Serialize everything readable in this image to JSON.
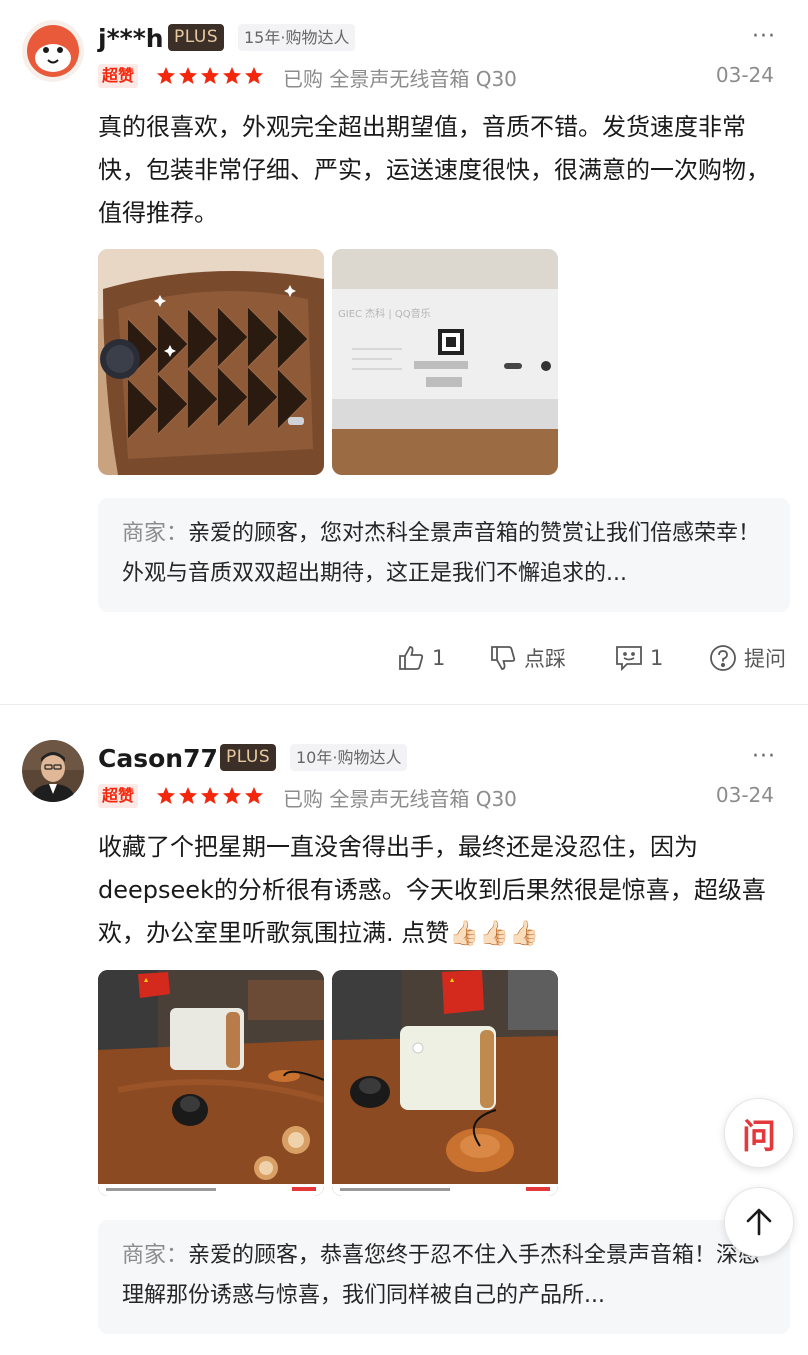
{
  "reviews": [
    {
      "username": "j***h",
      "plus": "PLUS",
      "years_tag": "15年·购物达人",
      "more": "···",
      "badge": "超赞",
      "rating": 5,
      "purchased": "已购 全景声无线音箱 Q30",
      "date": "03-24",
      "content": "真的很喜欢，外观完全超出期望值，音质不错。发货速度非常快，包装非常仔细、严实，运送速度很快，很满意的一次购物，值得推荐。",
      "photos": [
        {
          "icon": "speaker-photo-brown"
        },
        {
          "icon": "speaker-back-panel-photo"
        }
      ],
      "merchant_label": "商家：",
      "merchant_reply": "亲爱的顾客，您对杰科全景声音箱的赞赏让我们倍感荣幸！外观与音质双双超出期待，这正是我们不懈追求的...",
      "actions": {
        "like_count": "1",
        "dislike_label": "点踩",
        "comment_count": "1",
        "ask_label": "提问"
      }
    },
    {
      "username": "Cason77",
      "plus": "PLUS",
      "years_tag": "10年·购物达人",
      "more": "···",
      "badge": "超赞",
      "rating": 5,
      "purchased": "已购 全景声无线音箱 Q30",
      "date": "03-24",
      "content": "收藏了个把星期一直没舍得出手，最终还是没忍住，因为deepseek的分析很有诱惑。今天收到后果然很是惊喜，超级喜欢，办公室里听歌氛围拉满. 点赞👍🏻👍🏻👍🏻",
      "photos": [
        {
          "icon": "speaker-on-desk-photo"
        },
        {
          "icon": "speaker-on-desk-photo-2"
        }
      ],
      "merchant_label": "商家：",
      "merchant_reply": "亲爱的顾客，恭喜您终于忍不住入手杰科全景声音箱！深感理解那份诱惑与惊喜，我们同样被自己的产品所..."
    }
  ],
  "floating": {
    "ask_glyph": "问"
  },
  "colors": {
    "brand_red": "#e4393c",
    "star": "#f2270c",
    "plus_bg": "#3b2f28",
    "plus_text": "#e6c9a0"
  }
}
